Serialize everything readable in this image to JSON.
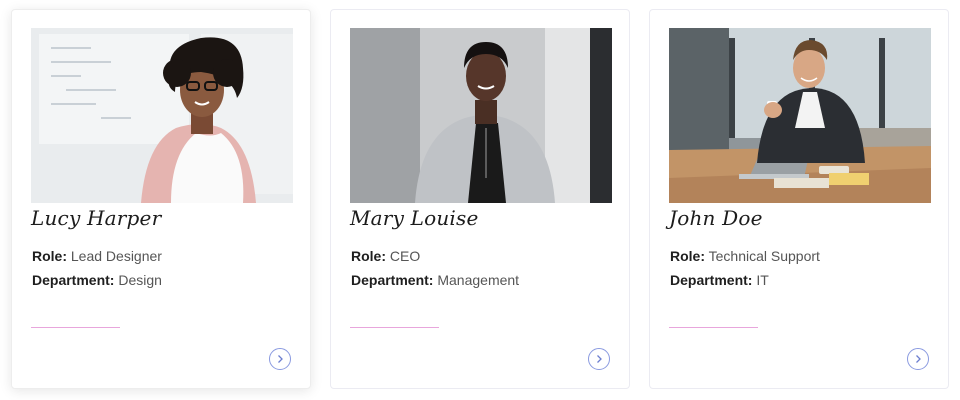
{
  "labels": {
    "role": "Role:",
    "department": "Department:"
  },
  "colors": {
    "accent_underline": "#e8a6dc",
    "button_outline": "#8a9ae0"
  },
  "icons": {
    "next": "chevron-right-icon"
  },
  "cards": [
    {
      "name": "Lucy Harper",
      "role": "Lead Designer",
      "department": "Design",
      "photo": "woman-glasses-whiteboard-photo"
    },
    {
      "name": "Mary Louise",
      "role": "CEO",
      "department": "Management",
      "photo": "woman-gray-blazer-photo"
    },
    {
      "name": "John Doe",
      "role": "Technical Support",
      "department": "IT",
      "photo": "man-laptop-coffee-photo"
    }
  ]
}
